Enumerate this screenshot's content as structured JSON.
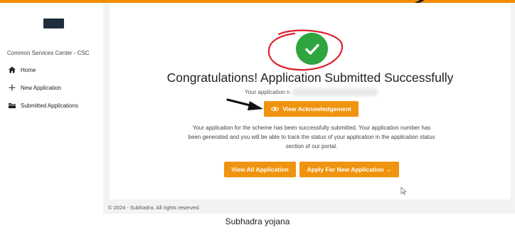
{
  "sidebar": {
    "org_name": "Common Services Center - CSC",
    "items": [
      {
        "label": "Home",
        "icon": "home-icon"
      },
      {
        "label": "New Application",
        "icon": "plus-icon"
      },
      {
        "label": "Submitted Applications",
        "icon": "folder-icon"
      }
    ]
  },
  "main": {
    "headline": "Congratulations! Application Submitted Successfully",
    "application_number_label": "Your application n",
    "view_ack_label": "View Acknowledgement",
    "message": "Your application for the scheme has been successfully submitted. Your application number has been generated and you will be able to track the status of your application in the application status section of our portal.",
    "view_all_label": "View All Application",
    "apply_new_label": "Apply For New Application →"
  },
  "footer": {
    "copyright": "© 2024 - Subhadra. All rights reserved."
  },
  "caption": "Subhadra yojana",
  "colors": {
    "accent": "#f0940f",
    "topbar": "#f28c00",
    "success": "#2ea53f",
    "annotation_circle": "#d9232e"
  }
}
